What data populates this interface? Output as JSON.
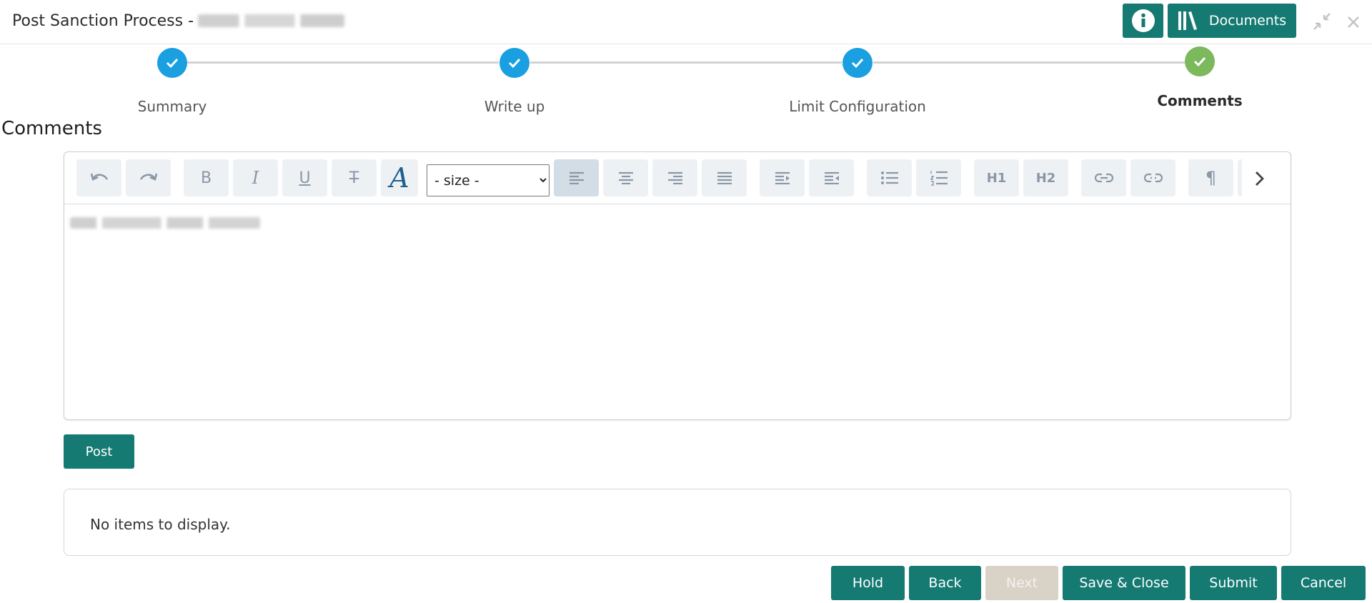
{
  "header": {
    "title": "Post Sanction Process -",
    "documents_label": "Documents"
  },
  "stepper": {
    "steps": [
      {
        "label": "Summary",
        "state": "done"
      },
      {
        "label": "Write up",
        "state": "done"
      },
      {
        "label": "Limit Configuration",
        "state": "done"
      },
      {
        "label": "Comments",
        "state": "current"
      }
    ],
    "colors": {
      "done": "#1a9fe0",
      "current": "#7cb85c"
    }
  },
  "section": {
    "title": "Comments"
  },
  "editor": {
    "size_select": {
      "selected": "- size -",
      "options": [
        "- size -"
      ]
    },
    "heading1": "H1",
    "heading2": "H2",
    "active_tool": "align-left"
  },
  "post_label": "Post",
  "comments_list": {
    "empty_text": "No items to display."
  },
  "footer": {
    "hold": "Hold",
    "back": "Back",
    "next": "Next",
    "save_close": "Save & Close",
    "submit": "Submit",
    "cancel": "Cancel"
  },
  "theme": {
    "primary": "#157a72",
    "disabled": "#d8d2c7"
  }
}
